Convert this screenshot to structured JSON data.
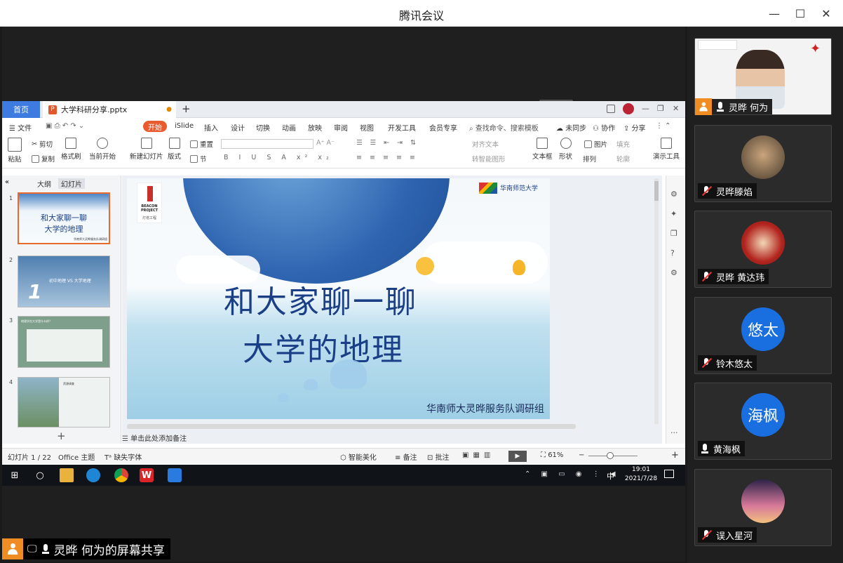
{
  "window": {
    "title": "腾讯会议"
  },
  "wps": {
    "home_tab": "首页",
    "doc_tab": "大学科研分享.pptx",
    "menu": [
      "文件",
      "开始",
      "iSlide",
      "插入",
      "设计",
      "切换",
      "动画",
      "放映",
      "审阅",
      "视图",
      "开发工具",
      "会员专享"
    ],
    "search": "查找命令、搜索模板",
    "menu_right": [
      "未同步",
      "协作",
      "分享"
    ],
    "ribbon": {
      "paste": "粘贴",
      "cut": "剪切",
      "copy": "复制",
      "format_painter": "格式刷",
      "start_from_current": "当前开始",
      "new_slide": "新建幻灯片",
      "layout": "版式",
      "section": "节",
      "reset": "重置",
      "align_text": "对齐文本",
      "to_smartart": "转智能图形",
      "textbox": "文本框",
      "shape": "形状",
      "arrange": "排列",
      "picture": "图片",
      "fill": "填充",
      "outline": "轮廓",
      "presentation_tools": "演示工具"
    },
    "panel_tabs": [
      "大纲",
      "幻灯片"
    ],
    "slides": [
      {
        "num": "1",
        "title": "和大家聊一聊\n大学的地理",
        "sub": "华南师大灵晔服务队调研组"
      },
      {
        "num": "2",
        "title": "初中地理 VS 大学地理",
        "big": "1"
      },
      {
        "num": "3",
        "title": "地理学在大学是什么样？"
      },
      {
        "num": "4",
        "title": "资源调查"
      }
    ],
    "slide": {
      "logo_text": "BEACON PROJECT",
      "logo_cn": "灯塔工程",
      "university": "华南师范大学",
      "title_line1": "和大家聊一聊",
      "title_line2": "大学的地理",
      "subtitle": "华南师大灵晔服务队调研组"
    },
    "notes_placeholder": "单击此处添加备注",
    "status": {
      "slide_count": "幻灯片 1 / 22",
      "theme": "Office 主题",
      "font_missing": "缺失字体",
      "smart_beautify": "智能美化",
      "notes": "备注",
      "comments": "批注",
      "zoom": "61%"
    }
  },
  "taskbar": {
    "time": "19:01",
    "date": "2021/7/28",
    "ime": "中"
  },
  "share_label": "灵晔 何为的屏幕共享",
  "participants": [
    {
      "name": "灵晔 何为",
      "type": "video",
      "mic": "on"
    },
    {
      "name": "灵晔滕焰",
      "type": "photo",
      "mic": "off"
    },
    {
      "name": "灵晔 黄达玮",
      "type": "photo",
      "mic": "off"
    },
    {
      "name": "铃木悠太",
      "type": "text",
      "avatar_text": "悠太",
      "mic": "off"
    },
    {
      "name": "黄海枫",
      "type": "text",
      "avatar_text": "海枫",
      "mic": "on"
    },
    {
      "name": "误入星河",
      "type": "photo",
      "mic": "off"
    }
  ],
  "colors": {
    "accent": "#1a6fe0",
    "wps_orange": "#e95b2e",
    "share_orange": "#f08c24"
  }
}
